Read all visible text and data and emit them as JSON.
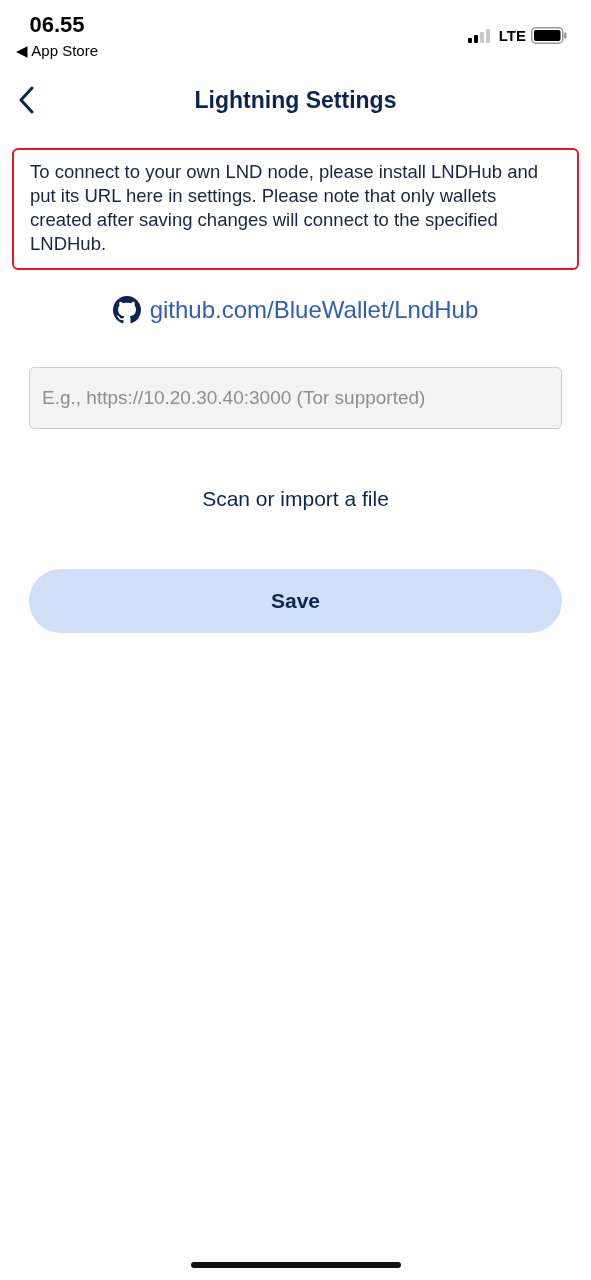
{
  "status_bar": {
    "time": "06.55",
    "back_app": "◀ App Store",
    "network": "LTE"
  },
  "nav": {
    "title": "Lightning Settings"
  },
  "notice": {
    "text": "To connect to your own LND node, please install LNDHub and put its URL here in settings. Please note that only wallets created after saving changes will connect to the specified LNDHub.",
    "highlighted": true
  },
  "link": {
    "text": "github.com/BlueWallet/LndHub"
  },
  "url_field": {
    "placeholder": "E.g., https://10.20.30.40:3000 (Tor supported)"
  },
  "scan_link": {
    "text": "Scan or import a file"
  },
  "save_button": {
    "label": "Save",
    "disabled": true
  }
}
